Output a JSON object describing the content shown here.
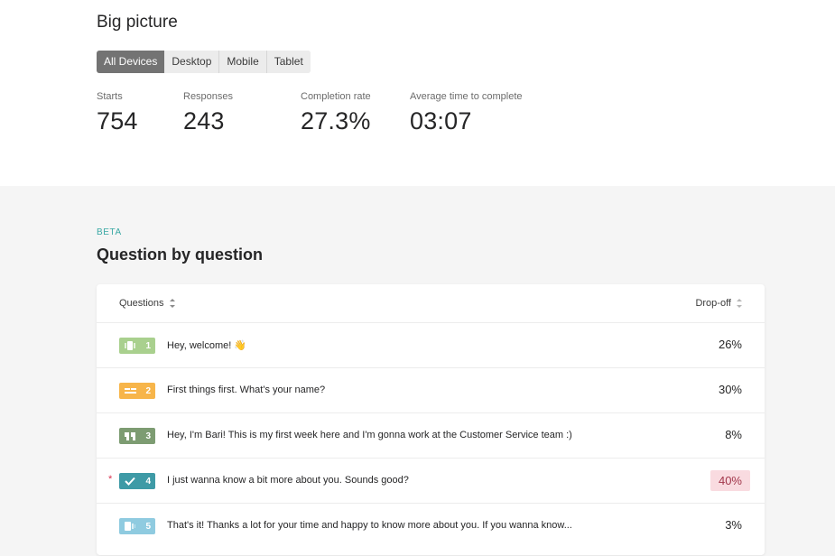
{
  "big_picture": {
    "title": "Big picture",
    "device_tabs": [
      {
        "label": "All Devices",
        "active": true
      },
      {
        "label": "Desktop",
        "active": false
      },
      {
        "label": "Mobile",
        "active": false
      },
      {
        "label": "Tablet",
        "active": false
      }
    ],
    "metrics": [
      {
        "label": "Starts",
        "value": "754"
      },
      {
        "label": "Responses",
        "value": "243"
      },
      {
        "label": "Completion rate",
        "value": "27.3%"
      },
      {
        "label": "Average time to complete",
        "value": "03:07"
      }
    ]
  },
  "question_by_question": {
    "beta_label": "BETA",
    "title": "Question by question",
    "header": {
      "questions": "Questions",
      "dropoff": "Drop-off"
    },
    "rows": [
      {
        "number": "1",
        "type_icon": "welcome-screen-icon",
        "color": "#a9d08e",
        "text": "Hey, welcome! 👋",
        "dropoff": "26%",
        "required": false,
        "highlight": false
      },
      {
        "number": "2",
        "type_icon": "short-text-icon",
        "color": "#f7b54a",
        "text": "First things first. What's your name?",
        "dropoff": "30%",
        "required": false,
        "highlight": false
      },
      {
        "number": "3",
        "type_icon": "statement-quote-icon",
        "color": "#7d9c72",
        "text": "Hey, I'm Bari! This is my first week here and I'm gonna work at the Customer Service team :)",
        "dropoff": "8%",
        "required": false,
        "highlight": false
      },
      {
        "number": "4",
        "type_icon": "yes-no-check-icon",
        "color": "#3e9aa6",
        "text": "I just wanna know a bit more about you. Sounds good?",
        "dropoff": "40%",
        "required": true,
        "highlight": true
      },
      {
        "number": "5",
        "type_icon": "end-screen-icon",
        "color": "#8fcbe0",
        "text": "That's it! Thanks a lot for your time and happy to know more about you. If you wanna know...",
        "dropoff": "3%",
        "required": false,
        "highlight": false
      }
    ],
    "required_marker": "*"
  }
}
